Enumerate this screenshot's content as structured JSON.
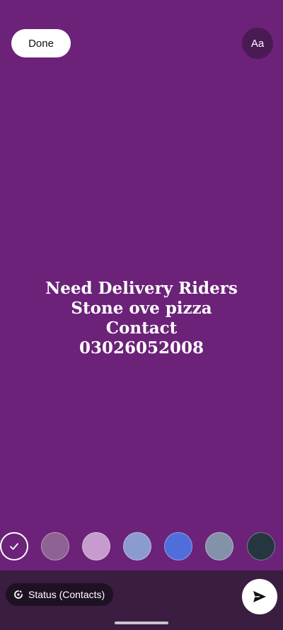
{
  "toolbar": {
    "done_label": "Done",
    "font_label": "Aa"
  },
  "status": {
    "text": "Need Delivery Riders\nStone ove pizza\nContact\n03026052008",
    "background_color": "#6c2279"
  },
  "palette": {
    "colors": [
      "#6c2279",
      "#8f6294",
      "#c69bcd",
      "#8c9bcf",
      "#4f6ddb",
      "#8392a8",
      "#263641"
    ],
    "selected_index": 0
  },
  "audience": {
    "label": "Status (Contacts)"
  },
  "icons": {
    "check": "check-icon",
    "privacy": "status-privacy-icon",
    "send": "send-icon"
  }
}
